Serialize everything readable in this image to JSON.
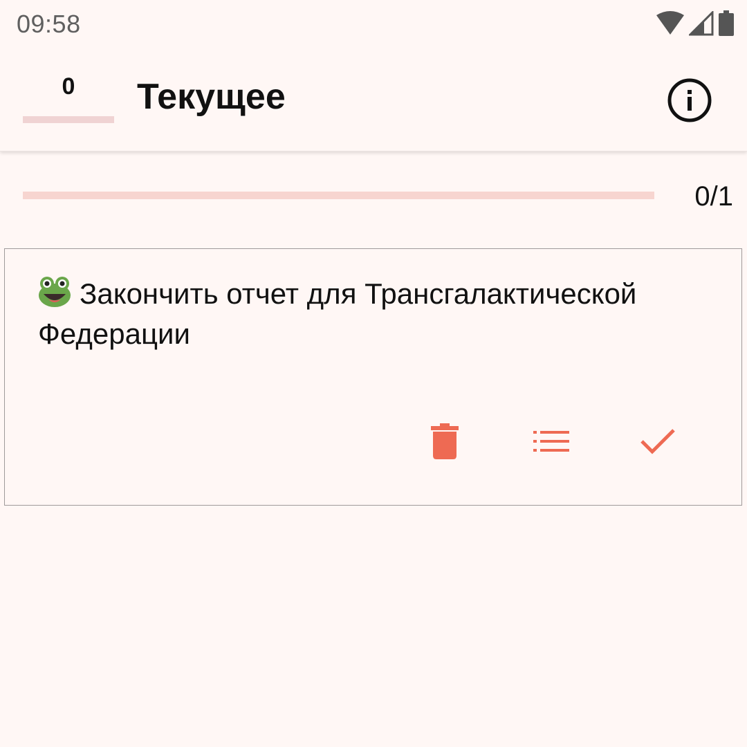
{
  "status_bar": {
    "time": "09:58",
    "icons": [
      "wifi-icon",
      "signal-icon",
      "battery-icon"
    ]
  },
  "app_bar": {
    "counter": "0",
    "title": "Текущее",
    "info_icon": "info-icon"
  },
  "progress": {
    "label": "0/1",
    "fraction": 0
  },
  "tasks": [
    {
      "emoji": "frog",
      "text": "Закончить отчет для Трансгалактической Федерации",
      "actions": [
        "delete-icon",
        "list-icon",
        "check-icon"
      ]
    }
  ],
  "colors": {
    "background": "#fff7f5",
    "accent": "#ee6a53",
    "progress_track": "#f7d5d0",
    "counter_underline": "#f0d3d3"
  }
}
